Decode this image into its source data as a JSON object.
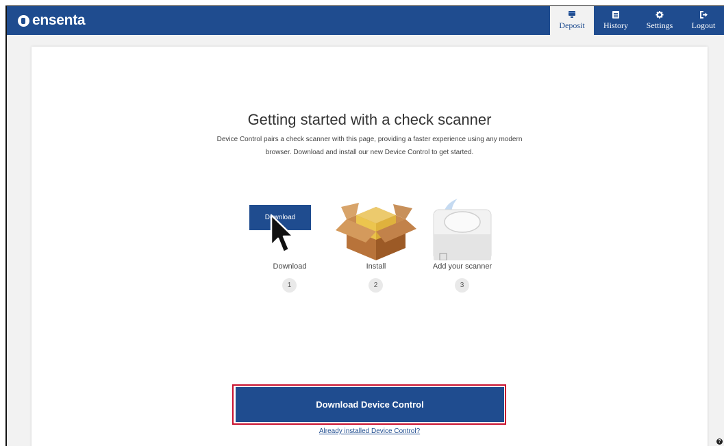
{
  "brand": {
    "name": "ensenta",
    "color": "#1f4c8f"
  },
  "nav": [
    {
      "label": "Deposit",
      "icon": "monitor-icon",
      "active": true
    },
    {
      "label": "History",
      "icon": "list-icon",
      "active": false
    },
    {
      "label": "Settings",
      "icon": "gear-icon",
      "active": false
    },
    {
      "label": "Logout",
      "icon": "logout-icon",
      "active": false
    }
  ],
  "main": {
    "title": "Getting started with a check scanner",
    "description": "Device Control pairs a check scanner with this page, providing a faster experience using any modern browser. Download and install our new Device Control to get started.",
    "steps": [
      {
        "label": "Download",
        "number": "1",
        "icon": "download-button-illustration",
        "button_label": "Download"
      },
      {
        "label": "Install",
        "number": "2",
        "icon": "package-box-icon"
      },
      {
        "label": "Add your scanner",
        "number": "3",
        "icon": "scanner-icon"
      }
    ],
    "cta_label": "Download Device Control",
    "link_label": "Already installed Device Control?"
  },
  "help_icon": "help-icon",
  "colors": {
    "accent": "#1f4c8f",
    "highlight": "#c8102e",
    "page_bg": "#f2f2f2"
  }
}
